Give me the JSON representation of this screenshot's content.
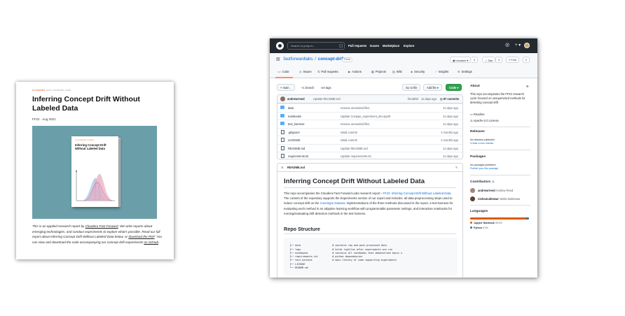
{
  "report": {
    "brand": "CLOUDERA",
    "brand_sub": "FAST FORWARD LABS",
    "title": "Inferring Concept Drift Without Labeled Data",
    "meta": "FF22 · Aug 2021",
    "book_brand": "CLOUDERA FAST FORWARD",
    "book_title": "Inferring Concept Drift Without Labeled Data",
    "desc_1": "This is an applied research report by ",
    "desc_link_1": "Cloudera Fast Forward",
    "desc_2": ". We write reports about emerging technologies, and conduct experiments to explore what's possible. Read our full report about Inferring Concept Drift Without Labeled Data below, or ",
    "desc_link_2": "download the PDF",
    "desc_3": ". You can view and download the code accompanying our concept drift experiments ",
    "desc_link_3": "on GitHub",
    "desc_4": ".",
    "cover_bg": "#6a9ea9",
    "brand_color": "#e36a2c"
  },
  "github": {
    "search_placeholder": "Search or jump to...",
    "search_key": "/",
    "nav": [
      "Pull requests",
      "Issues",
      "Marketplace",
      "Explore"
    ],
    "owner": "fastforwardlabs",
    "repo": "concept-drift",
    "visibility": "Public",
    "header_buttons": {
      "watch": "Unwatch",
      "watch_count": "4",
      "star": "Star",
      "star_count": "4",
      "fork": "Fork",
      "fork_count": "2"
    },
    "tabs": [
      "Code",
      "Issues",
      "Pull requests",
      "Actions",
      "Projects",
      "Wiki",
      "Security",
      "Insights",
      "Settings"
    ],
    "branch": "main",
    "branches": "1 branch",
    "tags": "0 tags",
    "go_to_file": "Go to file",
    "add_file": "Add file",
    "code_button": "Code",
    "last_commit": {
      "author": "andrewrreed",
      "message": "Update README.md",
      "hash": "f2e3d0d",
      "age": "11 days ago",
      "commits": "87 commits"
    },
    "files": [
      {
        "name": "data",
        "type": "folder",
        "message": "remove unneeded files",
        "age": "11 days ago"
      },
      {
        "name": "notebooks",
        "type": "folder",
        "message": "Update Covtype_experiment_dev.ipynb",
        "age": "11 days ago"
      },
      {
        "name": "test_harness",
        "type": "folder",
        "message": "remove unneeded files",
        "age": "11 days ago"
      },
      {
        "name": ".gitignore",
        "type": "file",
        "message": "initial commit",
        "age": "2 months ago"
      },
      {
        "name": "LICENSE",
        "type": "file",
        "message": "initial commit",
        "age": "2 months ago"
      },
      {
        "name": "README.md",
        "type": "file",
        "message": "Update README.md",
        "age": "11 days ago"
      },
      {
        "name": "requirements.txt",
        "type": "file",
        "message": "Update requirements.txt",
        "age": "11 days ago"
      }
    ],
    "readme": {
      "file_label": "README.md",
      "title": "Inferring Concept Drift Without Labeled Data",
      "para_1": "This repo accompanies the Cloudera Fast Forward Labs research report - ",
      "para_link_1": "FF22: Inferring Concept Drift Without Labeled Data",
      "para_2": ". The content of the repository supports the Experiments section of our report and includes: all data preprocessing steps used to induce concept drift on the ",
      "para_link_2": "Covertype Dataset",
      "para_3": ", implementations of the three methods discussed in the report, a test harness for evaluating each method in an adaptive learning workflow with programmable parameter settings, and interactive notebooks for running/evaluating drift detection methods in the test harness.",
      "structure_heading": "Repo Structure",
      "tree": ".\n├── data                      # contains raw and post-processed data\n├── logs                      # holds logfiles after experiments are run\n├── notebooks                 # contains all notebooks that demonstrate basic u\n├── requirements.txt          # python dependencies\n├── test_harness              # main library of code supporting experiments\n├── LICENSE\n└── README.md"
    },
    "sidebar": {
      "about_heading": "About",
      "about_text": "This repo accompanies the FF22 research cycle focused on unsupervised methods for detecting concept drift",
      "readme": "Readme",
      "license": "Apache-2.0 License",
      "releases_heading": "Releases",
      "releases_text": "No releases published",
      "releases_link": "Create a new release",
      "packages_heading": "Packages",
      "packages_text": "No packages published",
      "packages_link": "Publish your first package",
      "contributors_heading": "Contributors",
      "contributors_count": "2",
      "contributors": [
        {
          "login": "andrewrreed",
          "name": "Andrew Reed"
        },
        {
          "login": "nishamuktewar",
          "name": "Nisha Muktewar"
        }
      ],
      "languages_heading": "Languages",
      "languages": [
        {
          "name": "Jupyter Notebook",
          "percent": "95.0%",
          "color": "#da5b0b",
          "fraction": 0.95
        },
        {
          "name": "Python",
          "percent": "5.0%",
          "color": "#3572a5",
          "fraction": 0.05
        }
      ]
    },
    "colors": {
      "topbar": "#24292f",
      "link": "#0969da",
      "green_button": "#2da44e",
      "tab_underline": "#fd8c73"
    }
  }
}
